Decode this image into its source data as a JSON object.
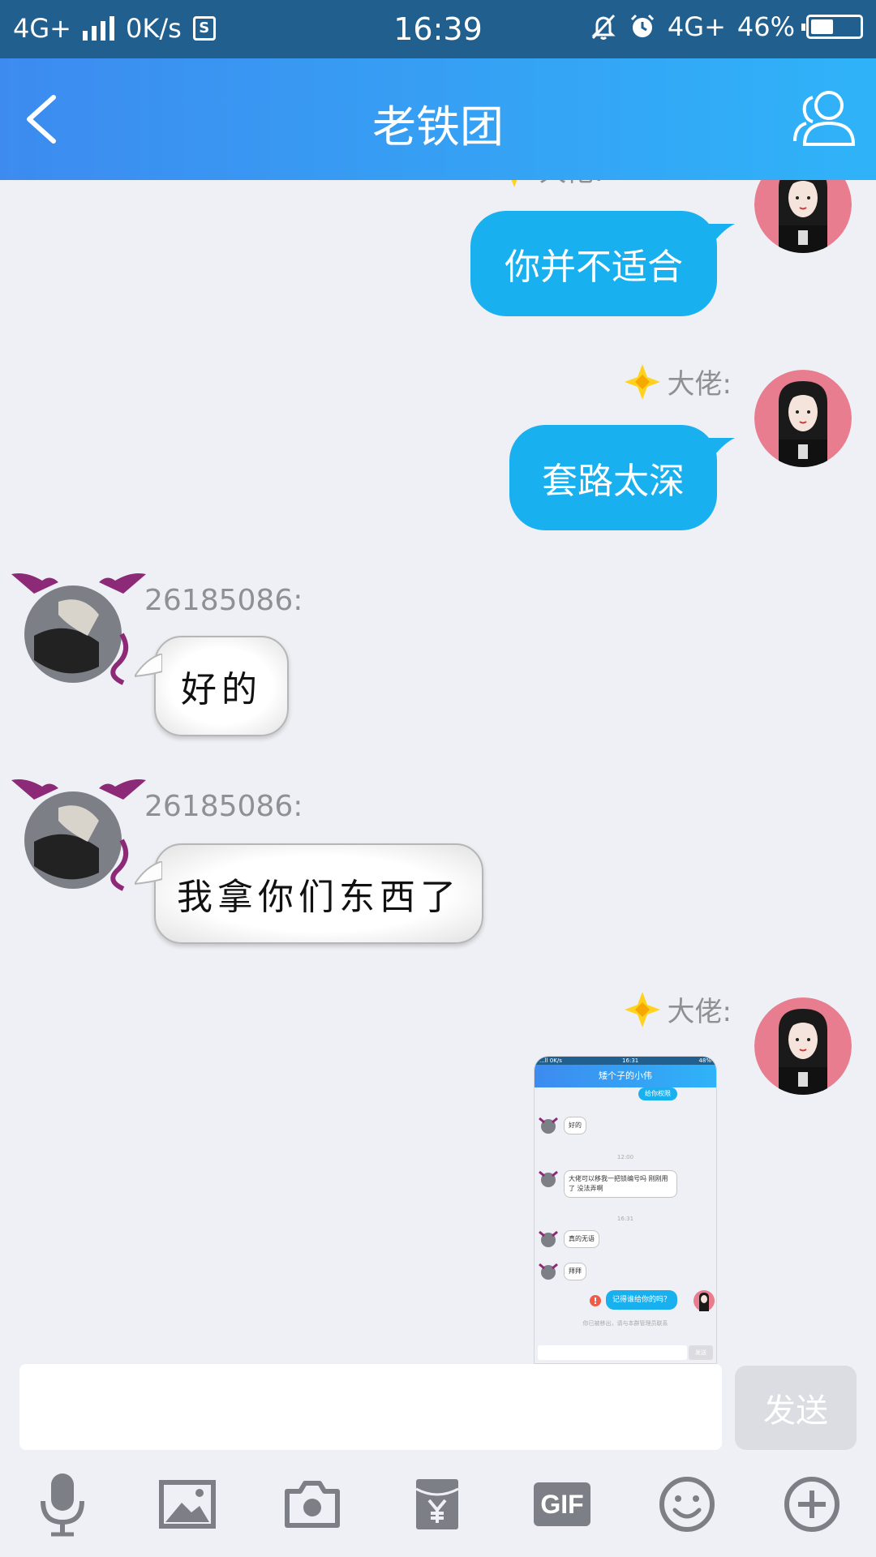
{
  "status_bar": {
    "network_left": "4G+",
    "speed": "0K/s",
    "sim_badge": "S",
    "time": "16:39",
    "network_right": "4G+",
    "battery": "46%",
    "battery_level": 0.46
  },
  "header": {
    "title": "老铁团",
    "back_icon": "chevron-left-icon",
    "members_icon": "group-members-icon"
  },
  "messages": [
    {
      "side": "right",
      "sender": "大佬:",
      "text": "你并不适合"
    },
    {
      "side": "right",
      "sender": "大佬:",
      "text": "套路太深"
    },
    {
      "side": "left",
      "sender": "26185086:",
      "text": "好的"
    },
    {
      "side": "left",
      "sender": "26185086:",
      "text": "我拿你们东西了"
    },
    {
      "side": "right",
      "sender": "大佬:",
      "type": "image"
    }
  ],
  "thumbnail": {
    "status_time": "16:31",
    "status_left": "...ll 0K/s",
    "status_right": "48%",
    "title": "矮个子的小伟",
    "top_bubble": "给你权限",
    "bubble1": "好的",
    "time1": "12:00",
    "bubble2": "大佬可以移我一把锁编号吗 刚刚用了 没法弄啊",
    "time2": "16:31",
    "bubble3": "真的无语",
    "bubble4": "拜拜",
    "blue_bubble": "记得谁给你的吗？",
    "notice": "你已被移出，请与本群管理员联系",
    "send": "发送"
  },
  "input": {
    "placeholder": "",
    "value": "",
    "send_label": "发送"
  },
  "toolbar": {
    "items": [
      "microphone-icon",
      "image-icon",
      "camera-icon",
      "red-packet-icon",
      "gif-icon",
      "emoji-icon",
      "plus-icon"
    ],
    "gif_label": "GIF"
  },
  "colors": {
    "bubble_blue": "#19b0f0",
    "header_start": "#3d8bef",
    "header_end": "#2fb3f8",
    "status_bar": "#205f8e",
    "background": "#eff0f5"
  }
}
